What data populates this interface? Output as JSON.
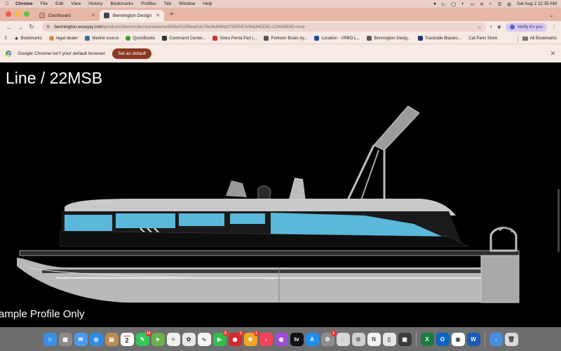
{
  "menubar": {
    "apple_icon": "apple-logo",
    "app_name": "Chrome",
    "items": [
      "File",
      "Edit",
      "View",
      "History",
      "Bookmarks",
      "Profiles",
      "Tab",
      "Window",
      "Help"
    ],
    "clock": "Sat Aug 2  11:35 AM"
  },
  "tabs": [
    {
      "label": "Dashboard",
      "active": false
    },
    {
      "label": "Bennington Design Center",
      "active": true
    }
  ],
  "toolbar": {
    "url_host": "bennington.eoscpq.com",
    "url_path": "/product/client/order/standalone/665b00295ea0cb78e9b868b3?SERIES/M&MODEL/22MSBSE=true",
    "verify_label": "Verify it's you"
  },
  "bookmarks": [
    {
      "label": "Bookmarks",
      "color": "#222222"
    },
    {
      "label": "regal dealer",
      "color": "#e0843a"
    },
    {
      "label": "Marine source",
      "color": "#3a6ea5"
    },
    {
      "label": "QuickBooks",
      "color": "#2ca01c"
    },
    {
      "label": "Command Center...",
      "color": "#333333"
    },
    {
      "label": "Volvo Penta Part |...",
      "color": "#d03030"
    },
    {
      "label": "Pontoon Boats by...",
      "color": "#555555"
    },
    {
      "label": "Location - VRBO L...",
      "color": "#1a4fa0"
    },
    {
      "label": "Bennington Desig...",
      "color": "#555555"
    },
    {
      "label": "Trackside Blazers...",
      "color": "#1a3a7a"
    },
    {
      "label": "Cat Parts Store",
      "color": "#f7e9e3"
    }
  ],
  "bookmarks_all": "All Bookmarks",
  "infobar": {
    "message": "Google Chrome isn't your default browser",
    "button": "Set as default"
  },
  "page": {
    "title": "Line / 22MSB",
    "note": "ample Profile Only",
    "boat_colors": {
      "hull_accent": "#5ab8dc",
      "panel_dark": "#1a1a1a",
      "tube": "#b9b9b9",
      "rail": "#cfcfcf"
    }
  },
  "dock": [
    {
      "name": "finder-icon",
      "color": "#3a8ee6",
      "glyph": "☺"
    },
    {
      "name": "launchpad-icon",
      "color": "#8a8a8a",
      "glyph": "▦"
    },
    {
      "name": "mail-icon",
      "color": "#4a9cf0",
      "glyph": "✉"
    },
    {
      "name": "safari-icon",
      "color": "#2f8be0",
      "glyph": "◎"
    },
    {
      "name": "notes-folder-icon",
      "color": "#b88a55",
      "glyph": "▤"
    },
    {
      "name": "calendar-icon",
      "color": "#ffffff",
      "glyph": "",
      "date_month": "AUG",
      "date_day": "2"
    },
    {
      "name": "messages-icon",
      "color": "#34c759",
      "glyph": "✎",
      "badge": "14"
    },
    {
      "name": "maps-icon",
      "color": "#6ab04c",
      "glyph": "➤"
    },
    {
      "name": "reminders-icon",
      "color": "#f0f0f0",
      "glyph": "≡"
    },
    {
      "name": "photos-icon",
      "color": "#e8e8e8",
      "glyph": "✿"
    },
    {
      "name": "freeform-icon",
      "color": "#f4f4f4",
      "glyph": "∿"
    },
    {
      "name": "facetime-icon",
      "color": "#2fbf4a",
      "glyph": "▶",
      "badge": "5"
    },
    {
      "name": "app-red-icon",
      "color": "#d12b2b",
      "glyph": "◉",
      "badge": "1"
    },
    {
      "name": "photos-flower-icon",
      "color": "#f5a623",
      "glyph": "❀",
      "badge": "1"
    },
    {
      "name": "music-icon",
      "color": "#f5405a",
      "glyph": "♪"
    },
    {
      "name": "podcasts-icon",
      "color": "#9c4fd6",
      "glyph": "◉"
    },
    {
      "name": "tv-icon",
      "color": "#111111",
      "glyph": "tv"
    },
    {
      "name": "app-store-icon",
      "color": "#1e8ef0",
      "glyph": "A"
    },
    {
      "name": "system-settings-icon",
      "color": "#8e8e8e",
      "glyph": "⚙",
      "badge": "1"
    },
    {
      "name": "app-gray-icon",
      "color": "#d8d8d8",
      "glyph": "◌"
    },
    {
      "name": "no-entry-icon",
      "color": "#cfcfcf",
      "glyph": "⊘"
    },
    {
      "name": "news-icon",
      "color": "#f2f2f2",
      "glyph": "N"
    },
    {
      "name": "iphone-mirroring-icon",
      "color": "#e6e6e6",
      "glyph": "▯"
    },
    {
      "name": "app-dark-icon",
      "color": "#3a3a3a",
      "glyph": "▣"
    },
    {
      "name": "excel-icon",
      "color": "#1d7a43",
      "glyph": "X"
    },
    {
      "name": "outlook-icon",
      "color": "#0a64c2",
      "glyph": "O"
    },
    {
      "name": "chrome-icon",
      "color": "#ffffff",
      "glyph": "◉"
    },
    {
      "name": "word-icon",
      "color": "#1c59b8",
      "glyph": "W"
    },
    {
      "name": "downloads-icon",
      "color": "#4a8be0",
      "glyph": "↓"
    },
    {
      "name": "trash-icon",
      "color": "#d9d9d9",
      "glyph": "🗑"
    }
  ]
}
